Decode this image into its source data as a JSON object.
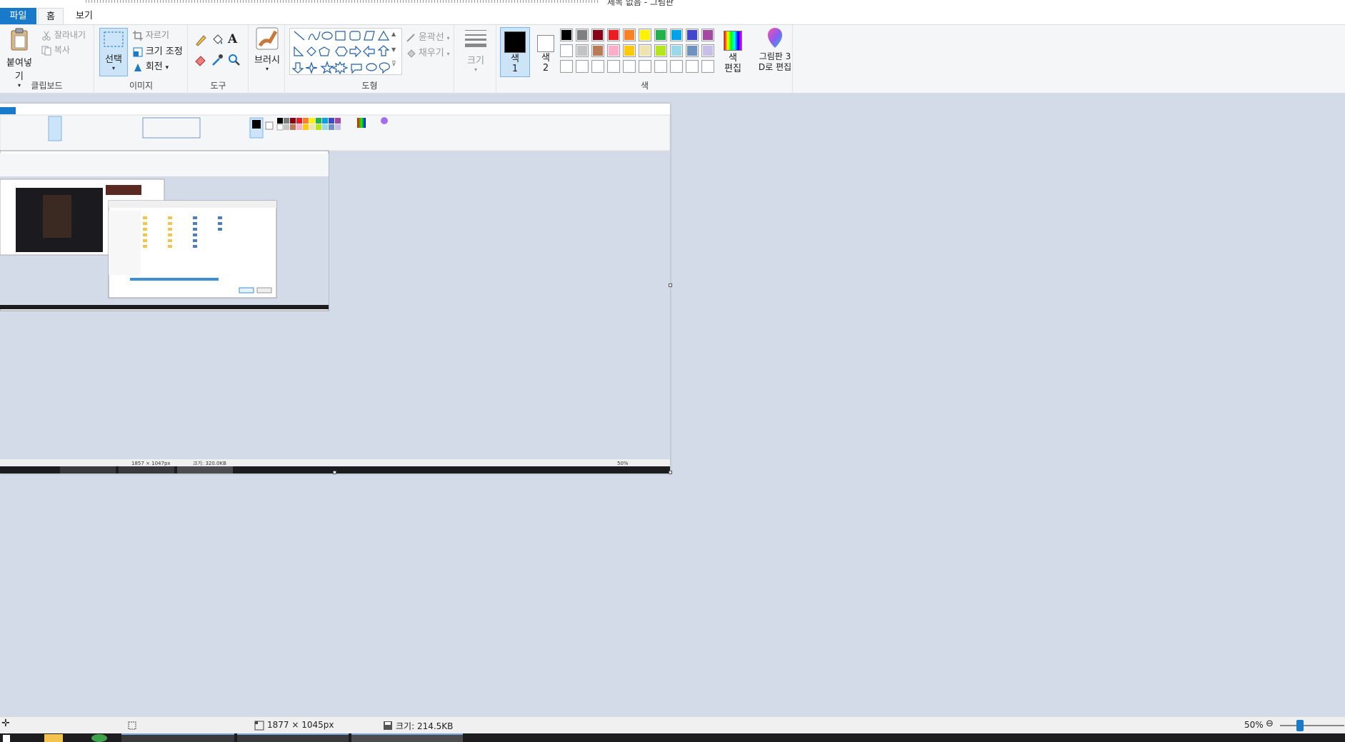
{
  "window": {
    "title": "제목 없음 - 그림판"
  },
  "tabs": {
    "file": "파일",
    "home": "홈",
    "view": "보기"
  },
  "clipboard": {
    "paste": "붙여넣기",
    "cut": "잘라내기",
    "copy": "복사",
    "label": "클립보드"
  },
  "image": {
    "select": "선택",
    "crop": "자르기",
    "resize": "크기 조정",
    "rotate": "회전",
    "label": "이미지"
  },
  "tools": {
    "label": "도구",
    "brushes": "브러시"
  },
  "shapes": {
    "outline": "윤곽선",
    "fill": "채우기",
    "label": "도형"
  },
  "size": {
    "label": "크기"
  },
  "colors": {
    "color1": "색\n1",
    "color1_a": "색",
    "color1_b": "1",
    "color2_a": "색",
    "color2_b": "2",
    "edit_a": "색",
    "edit_b": "편집",
    "label": "색",
    "row1": [
      "#000000",
      "#7f7f7f",
      "#880015",
      "#ed1c24",
      "#ff7f27",
      "#fff200",
      "#22b14c",
      "#00a2e8",
      "#3f48cc",
      "#a349a4"
    ],
    "row2": [
      "#ffffff",
      "#c3c3c3",
      "#b97a57",
      "#ffaec9",
      "#ffc90e",
      "#efe4b0",
      "#b5e61d",
      "#99d9ea",
      "#7092be",
      "#c8bfe7"
    ],
    "row3": [
      "#ffffff",
      "#ffffff",
      "#ffffff",
      "#ffffff",
      "#ffffff",
      "#ffffff",
      "#ffffff",
      "#ffffff",
      "#ffffff",
      "#ffffff"
    ]
  },
  "paint3d": {
    "line1": "그림판 3",
    "line2": "D로 편집"
  },
  "status": {
    "dimensions": "1877 × 1045px",
    "filesize": "크기: 214.5KB",
    "zoom": "50%"
  },
  "nested": {
    "dimensions": "1857 × 1047px",
    "filesize": "크기: 320.0KB",
    "zoom": "50%"
  }
}
